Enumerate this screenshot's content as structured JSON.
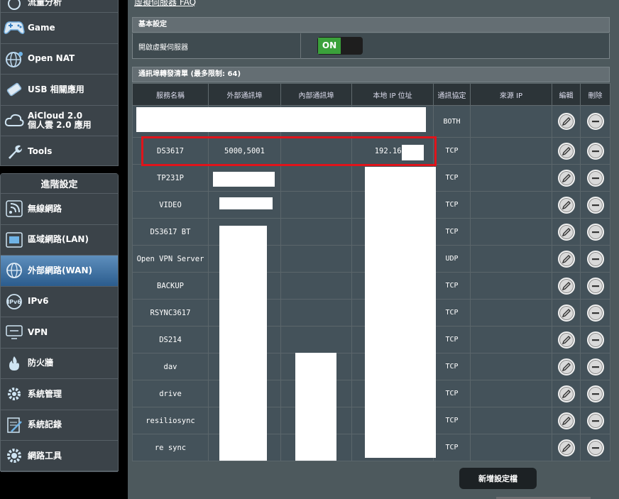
{
  "sidebar": {
    "items": [
      {
        "label": "流量分析",
        "icon": "traffic-analyzer-icon"
      },
      {
        "label": "Game",
        "icon": "game-controller-icon"
      },
      {
        "label": "Open NAT",
        "icon": "open-nat-globe-icon"
      },
      {
        "label": "USB 相關應用",
        "icon": "usb-icon"
      },
      {
        "label": "AiCloud 2.0",
        "label2": "個人雲 2.0 應用",
        "icon": "cloud-icon"
      },
      {
        "label": "Tools",
        "icon": "wrench-icon"
      }
    ],
    "advanced_header": "進階設定",
    "advanced_items": [
      {
        "label": "無線網路",
        "icon": "wireless-icon"
      },
      {
        "label": "區域網路(LAN)",
        "icon": "lan-icon"
      },
      {
        "label": "外部網路(WAN)",
        "icon": "wan-globe-icon",
        "active": true
      },
      {
        "label": "IPv6",
        "icon": "ipv6-icon"
      },
      {
        "label": "VPN",
        "icon": "vpn-icon"
      },
      {
        "label": "防火牆",
        "icon": "firewall-icon"
      },
      {
        "label": "系統管理",
        "icon": "admin-gear-icon"
      },
      {
        "label": "系統記錄",
        "icon": "system-log-icon"
      },
      {
        "label": "網路工具",
        "icon": "network-tools-icon"
      }
    ]
  },
  "main": {
    "faq_link": "虛擬伺服器 FAQ",
    "basic": {
      "title": "基本設定",
      "enable_label": "開啟虛擬伺服器",
      "toggle_state": "ON"
    },
    "list": {
      "title": "通訊埠轉發清單 (最多限制: 64)",
      "columns": [
        "服務名稱",
        "外部通訊埠",
        "內部通訊埠",
        "本地 IP 位址",
        "通訊協定",
        "來源 IP",
        "編輯",
        "刪除"
      ],
      "rows": [
        {
          "name": "",
          "ext": "",
          "int": "",
          "ip": "",
          "proto": "BOTH",
          "src": ""
        },
        {
          "name": "DS3617",
          "ext": "5000,5001",
          "int": "",
          "ip": "192.168.",
          "proto": "TCP",
          "src": ""
        },
        {
          "name": "TP231P",
          "ext": "",
          "int": "",
          "ip": "",
          "proto": "TCP",
          "src": ""
        },
        {
          "name": "VIDEO",
          "ext": "",
          "int": "",
          "ip": "",
          "proto": "TCP",
          "src": ""
        },
        {
          "name": "DS3617 BT",
          "ext": "",
          "int": "",
          "ip": "",
          "proto": "TCP",
          "src": ""
        },
        {
          "name": "Open VPN Server",
          "ext": "",
          "int": "",
          "ip": "",
          "proto": "UDP",
          "src": ""
        },
        {
          "name": "BACKUP",
          "ext": "",
          "int": "",
          "ip": "",
          "proto": "TCP",
          "src": ""
        },
        {
          "name": "RSYNC3617",
          "ext": "",
          "int": "",
          "ip": "",
          "proto": "TCP",
          "src": ""
        },
        {
          "name": "DS214",
          "ext": "",
          "int": "",
          "ip": "",
          "proto": "TCP",
          "src": ""
        },
        {
          "name": "dav",
          "ext": "",
          "int": "",
          "ip": "",
          "proto": "TCP",
          "src": ""
        },
        {
          "name": "drive",
          "ext": "",
          "int": "",
          "ip": "",
          "proto": "TCP",
          "src": ""
        },
        {
          "name": "resiliosync",
          "ext": "",
          "int": "",
          "ip": "",
          "proto": "TCP",
          "src": ""
        },
        {
          "name": "re sync",
          "ext": "",
          "int": "",
          "ip": "",
          "proto": "TCP",
          "src": ""
        }
      ]
    },
    "add_button": "新增設定檔"
  },
  "colors": {
    "highlight": "#e0141b",
    "toggle_on": "#3ba13b",
    "active_menu": "#2b5c8d"
  }
}
